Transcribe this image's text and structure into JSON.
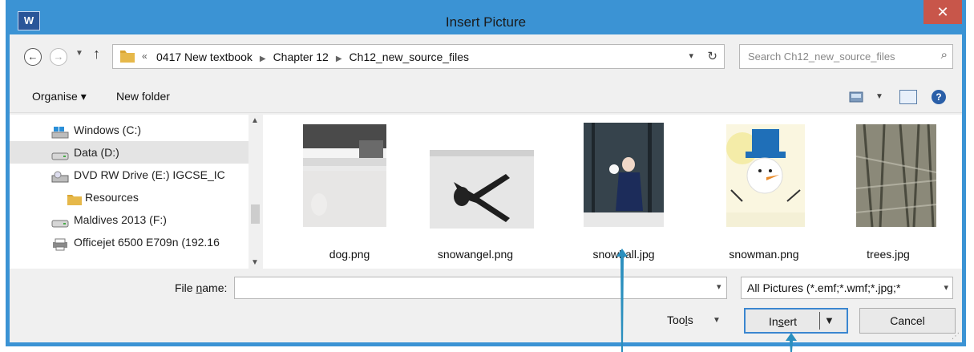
{
  "window": {
    "title": "Insert Picture",
    "app_icon_label": "W",
    "close_label": "✕"
  },
  "navigation": {
    "breadcrumb_overflow": "«",
    "breadcrumbs": [
      "0417 New textbook",
      "Chapter 12",
      "Ch12_new_source_files"
    ],
    "search_placeholder": "Search Ch12_new_source_files"
  },
  "toolbar": {
    "organise_label": "Organise ▾",
    "new_folder_label": "New folder"
  },
  "nav_tree": [
    {
      "label": "Windows (C:)",
      "icon": "drive-windows-icon",
      "selected": false
    },
    {
      "label": "Data (D:)",
      "icon": "drive-icon",
      "selected": true
    },
    {
      "label": "DVD RW Drive (E:) IGCSE_IC",
      "icon": "dvd-drive-icon",
      "selected": false
    },
    {
      "label": "Resources",
      "icon": "folder-icon",
      "selected": false
    },
    {
      "label": "Maldives 2013 (F:)",
      "icon": "drive-icon",
      "selected": false
    },
    {
      "label": "Officejet 6500 E709n (192.16",
      "icon": "network-printer-icon",
      "selected": false
    }
  ],
  "files": [
    {
      "name": "dog.png"
    },
    {
      "name": "snowangel.png"
    },
    {
      "name": "snowball.jpg"
    },
    {
      "name": "snowman.png"
    },
    {
      "name": "trees.jpg"
    }
  ],
  "bottom": {
    "file_name_label_pre": "File ",
    "file_name_label_mnemonic": "n",
    "file_name_label_post": "ame:",
    "file_name_value": "",
    "filter_value": "All Pictures (*.emf;*.wmf;*.jpg;*",
    "tools_label_pre": "Too",
    "tools_label_mnemonic": "l",
    "tools_label_post": "s",
    "insert_label_pre": "In",
    "insert_label_mnemonic": "s",
    "insert_label_post": "ert",
    "cancel_label": "Cancel"
  },
  "colors": {
    "title_bar": "#3b93d4",
    "close_button": "#c8564a",
    "annotation_arrow": "#2b8fbe"
  }
}
